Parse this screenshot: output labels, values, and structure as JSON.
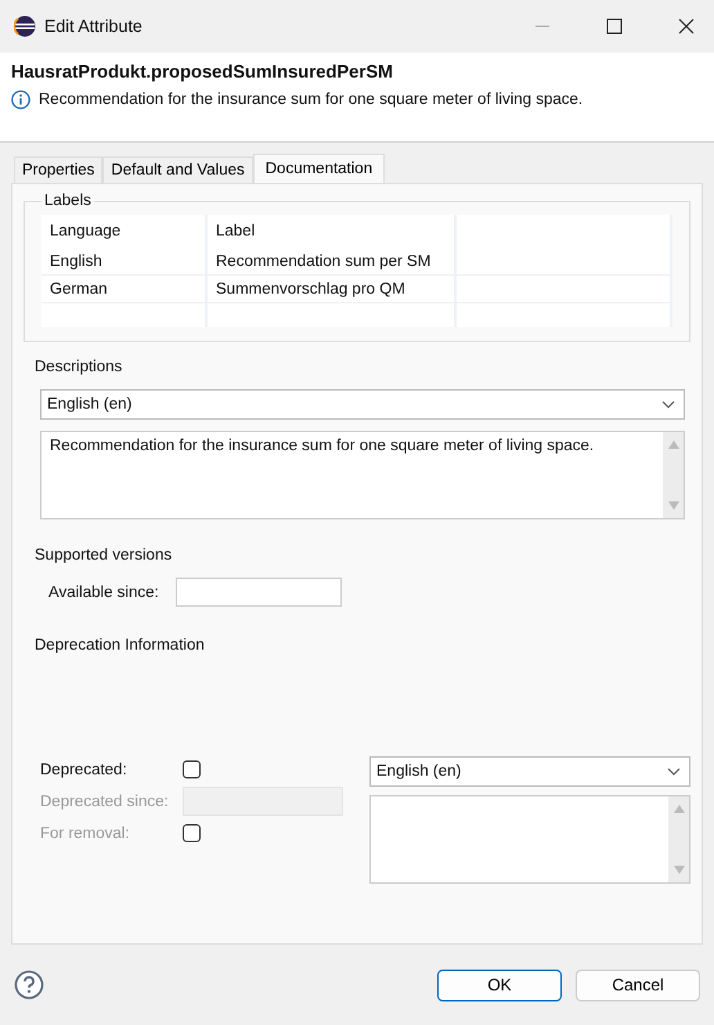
{
  "window": {
    "title": "Edit Attribute"
  },
  "header": {
    "title": "HausratProdukt.proposedSumInsuredPerSM",
    "message": "Recommendation for the insurance sum for one square meter of living space."
  },
  "tabs": [
    {
      "label": "Properties",
      "selected": false
    },
    {
      "label": "Default and Values",
      "selected": false
    },
    {
      "label": "Documentation",
      "selected": true
    }
  ],
  "labels": {
    "title": "Labels",
    "columns": [
      "Language",
      "Label"
    ],
    "rows": [
      [
        "English",
        "Recommendation sum per SM"
      ],
      [
        "German",
        "Summenvorschlag pro QM"
      ]
    ]
  },
  "descriptions": {
    "title": "Descriptions",
    "language": "English (en)",
    "text": "Recommendation for the insurance sum for one square meter of living space."
  },
  "supported_versions": {
    "title": "Supported versions",
    "available_since_label": "Available since:"
  },
  "deprecation": {
    "title": "Deprecation Information",
    "deprecated": {
      "label": "Deprecated:",
      "checked": false,
      "disabled": false
    },
    "deprecated_since": {
      "label": "Deprecated since:",
      "disabled": true
    },
    "for_removal": {
      "label": "For removal:",
      "checked": false,
      "disabled": true
    },
    "language": "English (en)"
  },
  "buttons": [
    {
      "label": "OK",
      "default": true
    },
    {
      "label": "Cancel",
      "default": false
    }
  ]
}
